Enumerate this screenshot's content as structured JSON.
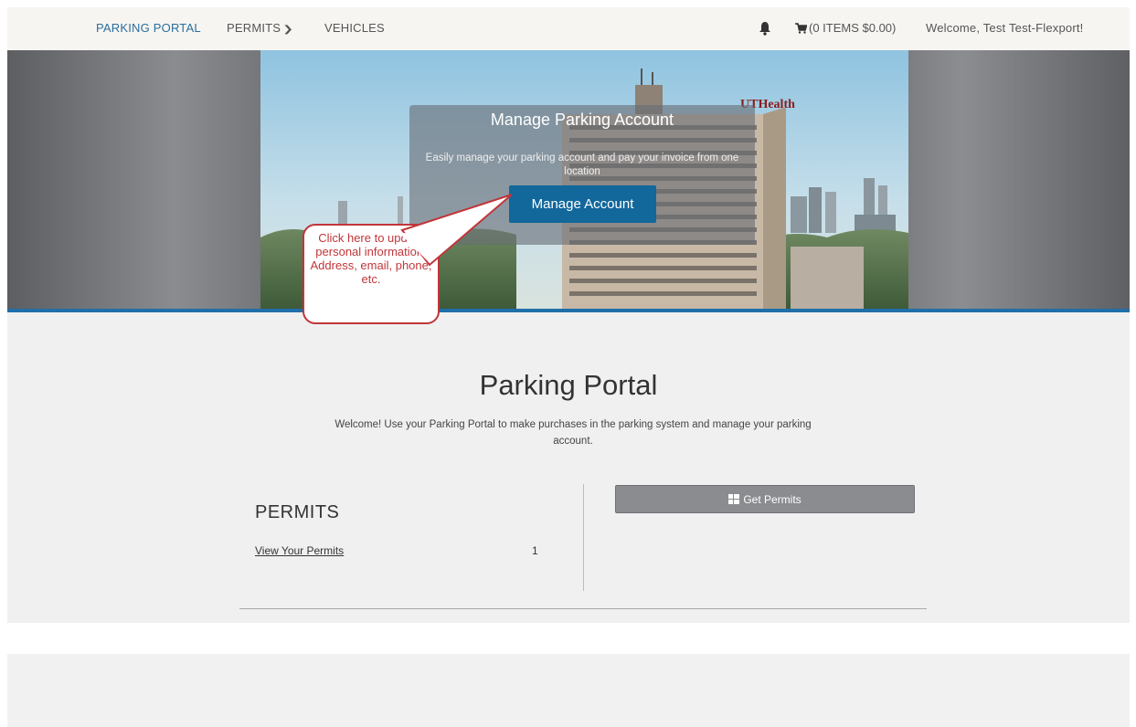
{
  "nav": {
    "brand": "PARKING PORTAL",
    "permits": "PERMITS",
    "vehicles": "VEHICLES",
    "cart": "(0 ITEMS $0.00)",
    "welcome": "Welcome, Test Test-Flexport!",
    "icons": [
      "bell-icon",
      "cart-icon",
      "chevron-down-icon"
    ]
  },
  "hero": {
    "title": "Manage Parking Account",
    "description": "Easily manage your parking account and pay your invoice from one location",
    "button": "Manage Account",
    "building_sign": "UTHealth",
    "callout": "Click here to update personal information. Address, email, phone, etc."
  },
  "main": {
    "title": "Parking Portal",
    "subtitle": "Welcome! Use your Parking Portal to make purchases in the parking system and manage your parking account.",
    "permits_heading": "PERMITS",
    "view_permits": "View Your Permits",
    "permits_count": "1",
    "get_permits": "Get Permits"
  },
  "colors": {
    "brand_link": "#2a6e9c",
    "primary_button": "#12679b",
    "hero_border": "#1f6fa8",
    "callout": "#c0363a",
    "secondary_button": "#8a8c90"
  }
}
